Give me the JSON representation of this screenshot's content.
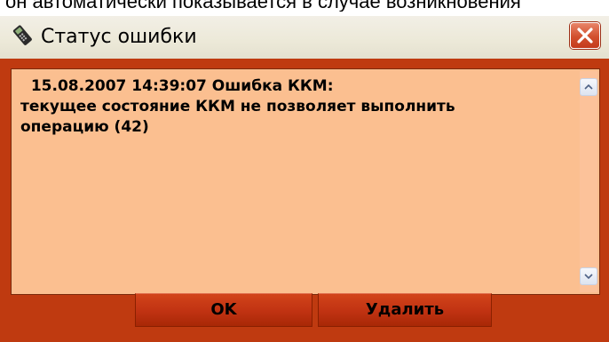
{
  "caption_text": "он автоматически показывается в случае возникновения",
  "window": {
    "title": "Статус ошибки",
    "app_icon": "ccm-device-icon",
    "close_icon": "close-x-icon"
  },
  "message": {
    "text": "  15.08.2007 14:39:07 Ошибка ККМ:\nтекущее состояние ККМ не позволяет выполнить\nоперацию (42)"
  },
  "buttons": {
    "ok_label": "OK",
    "delete_label": "Удалить"
  },
  "colors": {
    "window_frame": "#bf3a10",
    "message_background": "#fbbf90",
    "button_background": "#c03212"
  }
}
